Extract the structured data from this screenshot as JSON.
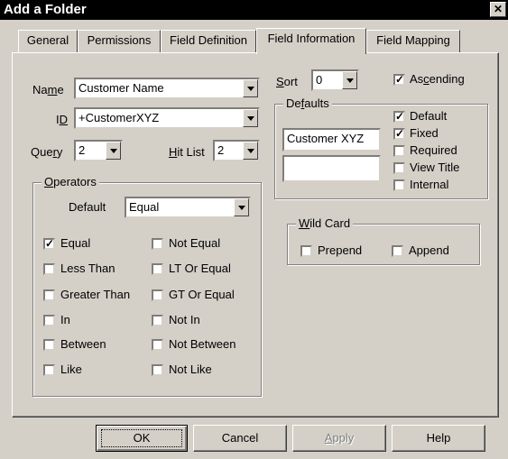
{
  "window": {
    "title": "Add a Folder",
    "close_glyph": "✕"
  },
  "tabs": [
    "General",
    "Permissions",
    "Field Definition",
    "Field Information",
    "Field Mapping"
  ],
  "active_tab": "Field Information",
  "name": {
    "label_pre": "Na",
    "label_u": "m",
    "label_post": "e",
    "value": "Customer Name"
  },
  "id": {
    "label_pre": "I",
    "label_u": "D",
    "label_post": "",
    "value": "+CustomerXYZ"
  },
  "query": {
    "label_pre": "Que",
    "label_u": "r",
    "label_post": "y",
    "value": "2"
  },
  "hitlist": {
    "label_pre": "",
    "label_u": "H",
    "label_post": "it List",
    "value": "2"
  },
  "sort": {
    "label_pre": "",
    "label_u": "S",
    "label_post": "ort",
    "value": "0"
  },
  "ascending": {
    "label_pre": "As",
    "label_u": "c",
    "label_post": "ending",
    "checked": true
  },
  "operators": {
    "title_pre": "",
    "title_u": "O",
    "title_post": "perators",
    "default_label": "Default",
    "default_value": "Equal",
    "items": [
      {
        "label": "Equal",
        "checked": true
      },
      {
        "label": "Not Equal",
        "checked": false
      },
      {
        "label": "Less Than",
        "checked": false
      },
      {
        "label": "LT Or Equal",
        "checked": false
      },
      {
        "label": "Greater Than",
        "checked": false
      },
      {
        "label": "GT Or Equal",
        "checked": false
      },
      {
        "label": "In",
        "checked": false
      },
      {
        "label": "Not In",
        "checked": false
      },
      {
        "label": "Between",
        "checked": false
      },
      {
        "label": "Not Between",
        "checked": false
      },
      {
        "label": "Like",
        "checked": false
      },
      {
        "label": "Not Like",
        "checked": false
      }
    ]
  },
  "defaults": {
    "title_pre": "De",
    "title_u": "f",
    "title_post": "aults",
    "value1": "Customer XYZ",
    "value2": "",
    "checks": [
      {
        "label": "Default",
        "checked": true
      },
      {
        "label": "Fixed",
        "checked": true
      },
      {
        "label": "Required",
        "checked": false
      },
      {
        "label": "View Title",
        "checked": false
      },
      {
        "label": "Internal",
        "checked": false
      }
    ]
  },
  "wildcard": {
    "title_pre": "",
    "title_u": "W",
    "title_post": "ild Card",
    "prepend": {
      "label": "Prepend",
      "checked": false
    },
    "append": {
      "label": "Append",
      "checked": false
    }
  },
  "buttons": {
    "ok": "OK",
    "cancel": "Cancel",
    "apply_u": "A",
    "apply_post": "pply",
    "help": "Help"
  },
  "check_glyph": "✓"
}
